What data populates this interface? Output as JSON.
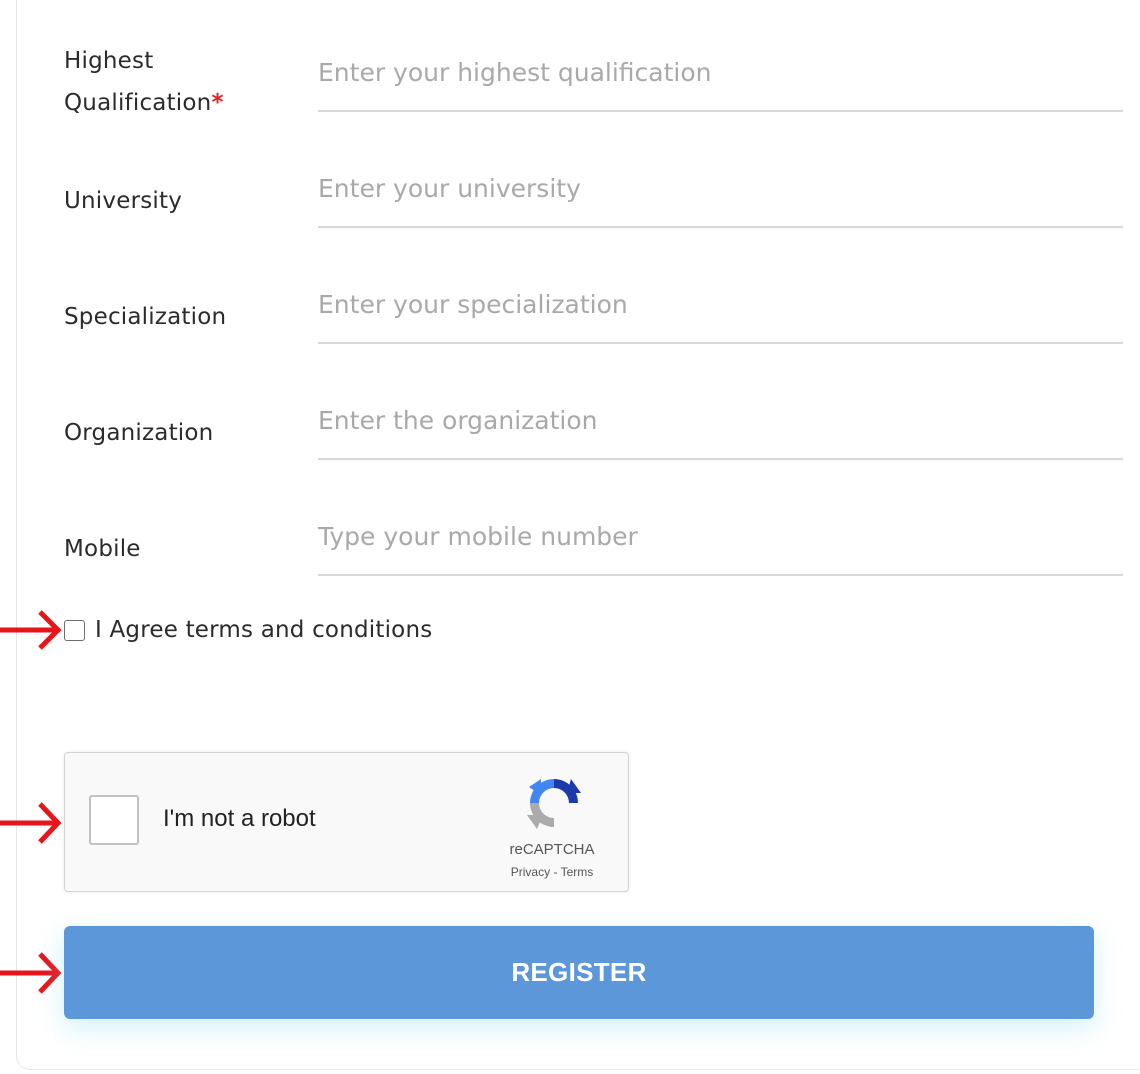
{
  "form": {
    "fields": [
      {
        "label_line1": "Highest",
        "label_line2": "Qualification",
        "required_mark": "*",
        "placeholder": "Enter your highest qualification",
        "value": ""
      },
      {
        "label": "University",
        "placeholder": "Enter your university",
        "value": ""
      },
      {
        "label": "Specialization",
        "placeholder": "Enter your specialization",
        "value": ""
      },
      {
        "label": "Organization",
        "placeholder": "Enter the organization",
        "value": ""
      },
      {
        "label": "Mobile",
        "placeholder": "Type your mobile number",
        "value": ""
      }
    ],
    "agree_label": "I Agree terms and conditions",
    "recaptcha": {
      "label": "I'm not a robot",
      "brand": "reCAPTCHA",
      "privacy": "Privacy",
      "separator": " - ",
      "terms": "Terms"
    },
    "register_label": "REGISTER"
  },
  "colors": {
    "accent": "#5b97d9",
    "required": "#e02424",
    "arrow": "#e8141b"
  },
  "icons": [
    "arrow-right-icon",
    "recaptcha-logo-icon"
  ]
}
